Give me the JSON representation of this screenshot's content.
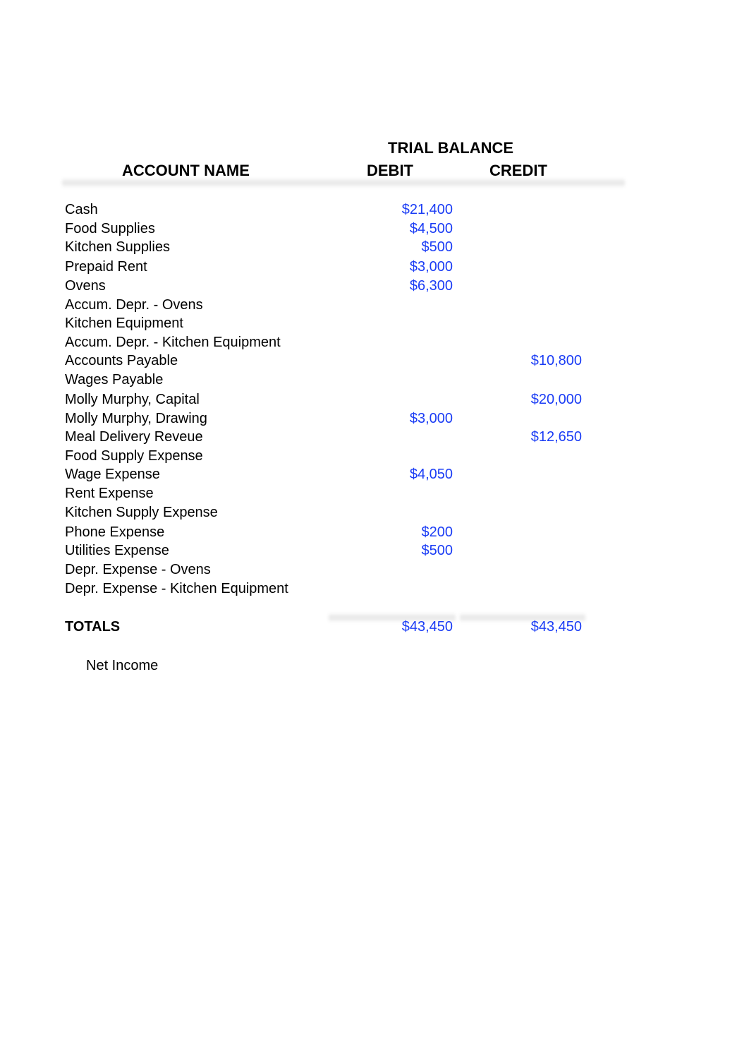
{
  "header": {
    "title": "TRIAL BALANCE",
    "col_account": "ACCOUNT NAME",
    "col_debit": "DEBIT",
    "col_credit": "CREDIT"
  },
  "accent_color": "#1a3cf5",
  "rows": [
    {
      "name": "Cash",
      "debit": "$21,400",
      "credit": ""
    },
    {
      "name": "Food Supplies",
      "debit": "$4,500",
      "credit": ""
    },
    {
      "name": "Kitchen Supplies",
      "debit": "$500",
      "credit": ""
    },
    {
      "name": "Prepaid Rent",
      "debit": "$3,000",
      "credit": ""
    },
    {
      "name": "Ovens",
      "debit": "$6,300",
      "credit": ""
    },
    {
      "name": "Accum. Depr. - Ovens",
      "debit": "",
      "credit": ""
    },
    {
      "name": "Kitchen Equipment",
      "debit": "",
      "credit": ""
    },
    {
      "name": "Accum. Depr. - Kitchen Equipment",
      "debit": "",
      "credit": ""
    },
    {
      "name": "Accounts Payable",
      "debit": "",
      "credit": "$10,800"
    },
    {
      "name": "Wages Payable",
      "debit": "",
      "credit": ""
    },
    {
      "name": "Molly Murphy, Capital",
      "debit": "",
      "credit": "$20,000"
    },
    {
      "name": "Molly Murphy, Drawing",
      "debit": "$3,000",
      "credit": ""
    },
    {
      "name": "Meal Delivery Reveue",
      "debit": "",
      "credit": "$12,650"
    },
    {
      "name": "Food Supply Expense",
      "debit": "",
      "credit": ""
    },
    {
      "name": "Wage Expense",
      "debit": "$4,050",
      "credit": ""
    },
    {
      "name": "Rent Expense",
      "debit": "",
      "credit": ""
    },
    {
      "name": "Kitchen Supply Expense",
      "debit": "",
      "credit": ""
    },
    {
      "name": "Phone Expense",
      "debit": "$200",
      "credit": ""
    },
    {
      "name": "Utilities Expense",
      "debit": "$500",
      "credit": ""
    },
    {
      "name": "Depr. Expense - Ovens",
      "debit": "",
      "credit": ""
    },
    {
      "name": "Depr. Expense - Kitchen Equipment",
      "debit": "",
      "credit": ""
    }
  ],
  "totals": {
    "label": "TOTALS",
    "debit": "$43,450",
    "credit": "$43,450"
  },
  "net_income": {
    "label": "Net Income",
    "value": ""
  }
}
